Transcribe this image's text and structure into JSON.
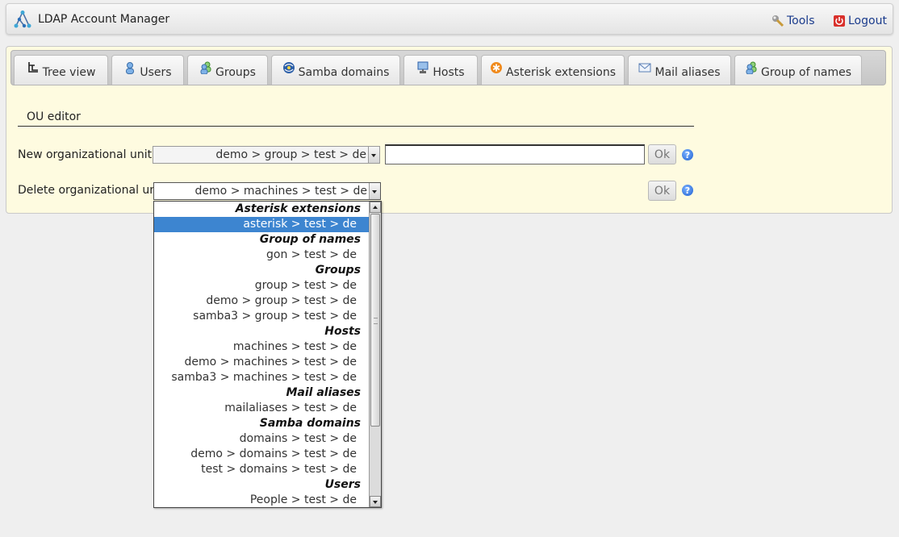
{
  "header": {
    "app_title": "LDAP Account Manager",
    "tools_label": "Tools",
    "logout_label": "Logout"
  },
  "tabs": [
    {
      "label": "Tree view",
      "icon": "tree-view-icon"
    },
    {
      "label": "Users",
      "icon": "user-icon"
    },
    {
      "label": "Groups",
      "icon": "group-icon"
    },
    {
      "label": "Samba domains",
      "icon": "samba-domain-icon"
    },
    {
      "label": "Hosts",
      "icon": "host-icon"
    },
    {
      "label": "Asterisk extensions",
      "icon": "asterisk-icon"
    },
    {
      "label": "Mail aliases",
      "icon": "mail-icon"
    },
    {
      "label": "Group of names",
      "icon": "group-of-names-icon"
    }
  ],
  "editor": {
    "title": "OU editor",
    "new_ou_label": "New organizational unit",
    "new_ou_selected": "demo > group > test > de",
    "new_ou_name_value": "",
    "delete_ou_label": "Delete organizational unit",
    "delete_ou_selected": "demo > machines > test > de",
    "ok_label": "Ok",
    "help_symbol": "?"
  },
  "dropdown_options": [
    {
      "text": "Asterisk extensions",
      "group": true
    },
    {
      "text": "asterisk > test > de",
      "selected": true
    },
    {
      "text": "Group of names",
      "group": true
    },
    {
      "text": "gon > test > de"
    },
    {
      "text": "Groups",
      "group": true
    },
    {
      "text": "group > test > de"
    },
    {
      "text": "demo > group > test > de"
    },
    {
      "text": "samba3 > group > test > de"
    },
    {
      "text": "Hosts",
      "group": true
    },
    {
      "text": "machines > test > de"
    },
    {
      "text": "demo > machines > test > de"
    },
    {
      "text": "samba3 > machines > test > de"
    },
    {
      "text": "Mail aliases",
      "group": true
    },
    {
      "text": "mailaliases > test > de"
    },
    {
      "text": "Samba domains",
      "group": true
    },
    {
      "text": "domains > test > de"
    },
    {
      "text": "demo > domains > test > de"
    },
    {
      "text": "test > domains > test > de"
    },
    {
      "text": "Users",
      "group": true
    },
    {
      "text": "People > test > de"
    }
  ],
  "colors": {
    "panel_background": "#fefbe0",
    "selection": "#3d85d0",
    "link": "#1a3b8c"
  }
}
